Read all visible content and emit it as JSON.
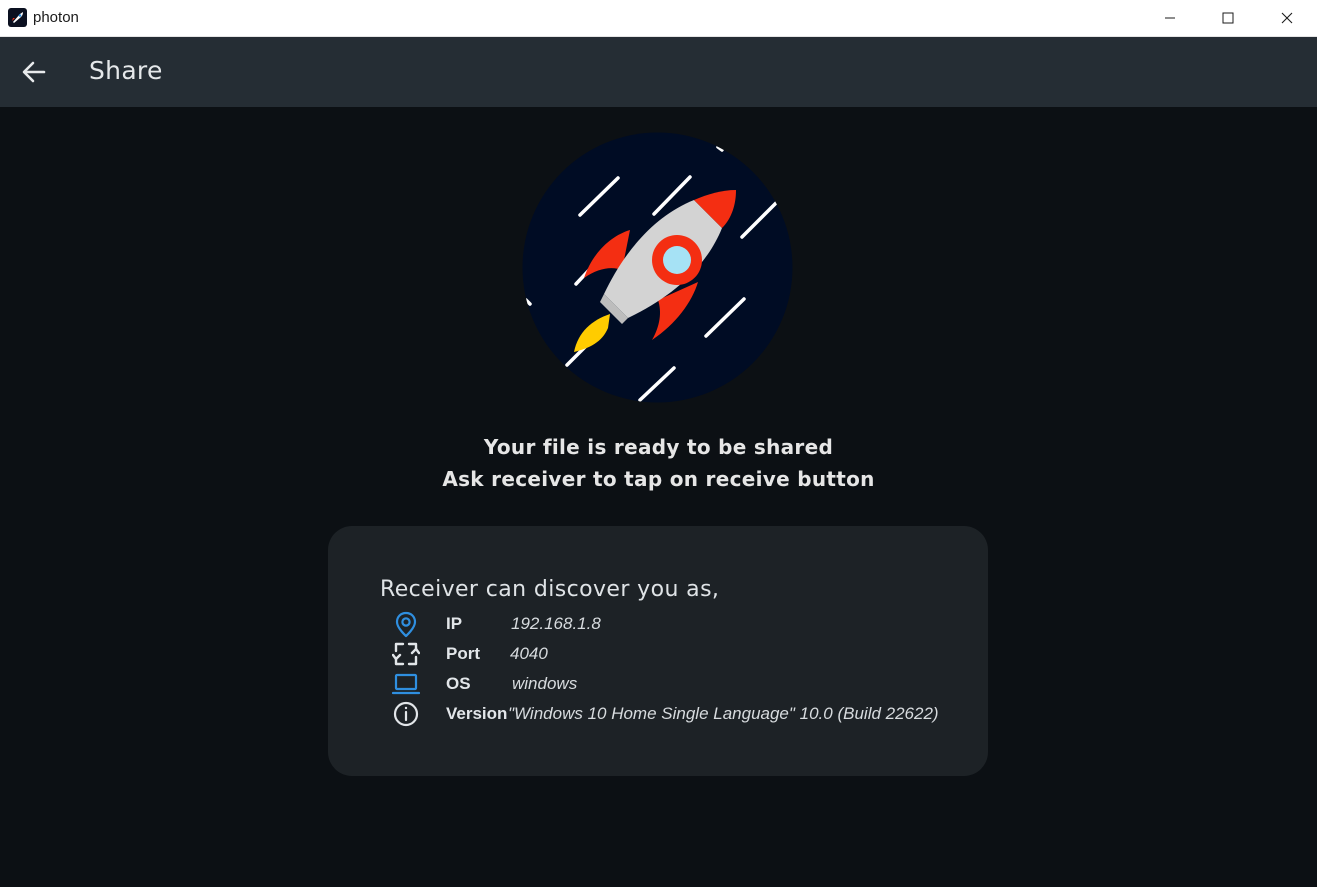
{
  "window": {
    "title": "photon"
  },
  "appbar": {
    "title": "Share"
  },
  "message": {
    "line1": "Your file is ready to be shared",
    "line2": "Ask receiver to tap on receive button"
  },
  "discovery": {
    "title": "Receiver can discover you as,",
    "rows": [
      {
        "label": "IP",
        "value": "192.168.1.8",
        "icon": "location-pin-icon"
      },
      {
        "label": "Port",
        "value": "4040",
        "icon": "sync-arrows-icon"
      },
      {
        "label": "OS",
        "value": "windows",
        "icon": "laptop-icon"
      },
      {
        "label": "Version",
        "value": "\"Windows 10 Home Single Language\" 10.0 (Build 22622)",
        "icon": "info-icon"
      }
    ]
  },
  "colors": {
    "background": "#0c1014",
    "appbar": "#252d34",
    "card": "#1d2226",
    "accent_blue": "#2f8fe0",
    "rocket_red": "#f42e12",
    "rocket_body": "#d3d3d3",
    "rocket_window": "#a6e2f5",
    "flame": "#ffcc00",
    "space": "#000c24"
  }
}
